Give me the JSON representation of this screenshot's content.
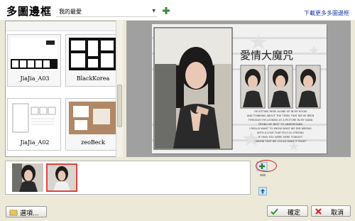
{
  "header": {
    "title": "多圖邊框",
    "category_value": "我的最愛",
    "more_link": "下載更多多圖邊框"
  },
  "frames": [
    {
      "label": "JiaJia_A03"
    },
    {
      "label": "BlackKorea"
    },
    {
      "label": "JiaJia_A02"
    },
    {
      "label": "zeoBeck"
    }
  ],
  "preview": {
    "heading": "愛情大魔咒",
    "poem": [
      "I'M SITTING HERE ALONE UP IN MY ROOM",
      "AND THINKING ABOUT THE TIMES THAT WE'VE BEEN",
      "THROUGH I'M LOOKING AT A PICTURE IN MY HAND",
      "TRYING MY BEST TO UNDERSTAND",
      "I REALLY WANT TO KNOW WHAT WE DID WRONG",
      "WITH A LOVE THAT FELT SO STRONG",
      "IF ONLY YOU WERE HERE TONIGHT",
      "I KNOW THAT WE COULD MAKE IT RIGHT"
    ]
  },
  "strip": {
    "side_caption": "ww"
  },
  "footer": {
    "options_label": "選項...",
    "ok_label": "確定",
    "cancel_label": "取消"
  },
  "colors": {
    "accent_link": "#1a3da8",
    "selection": "#e04040"
  }
}
